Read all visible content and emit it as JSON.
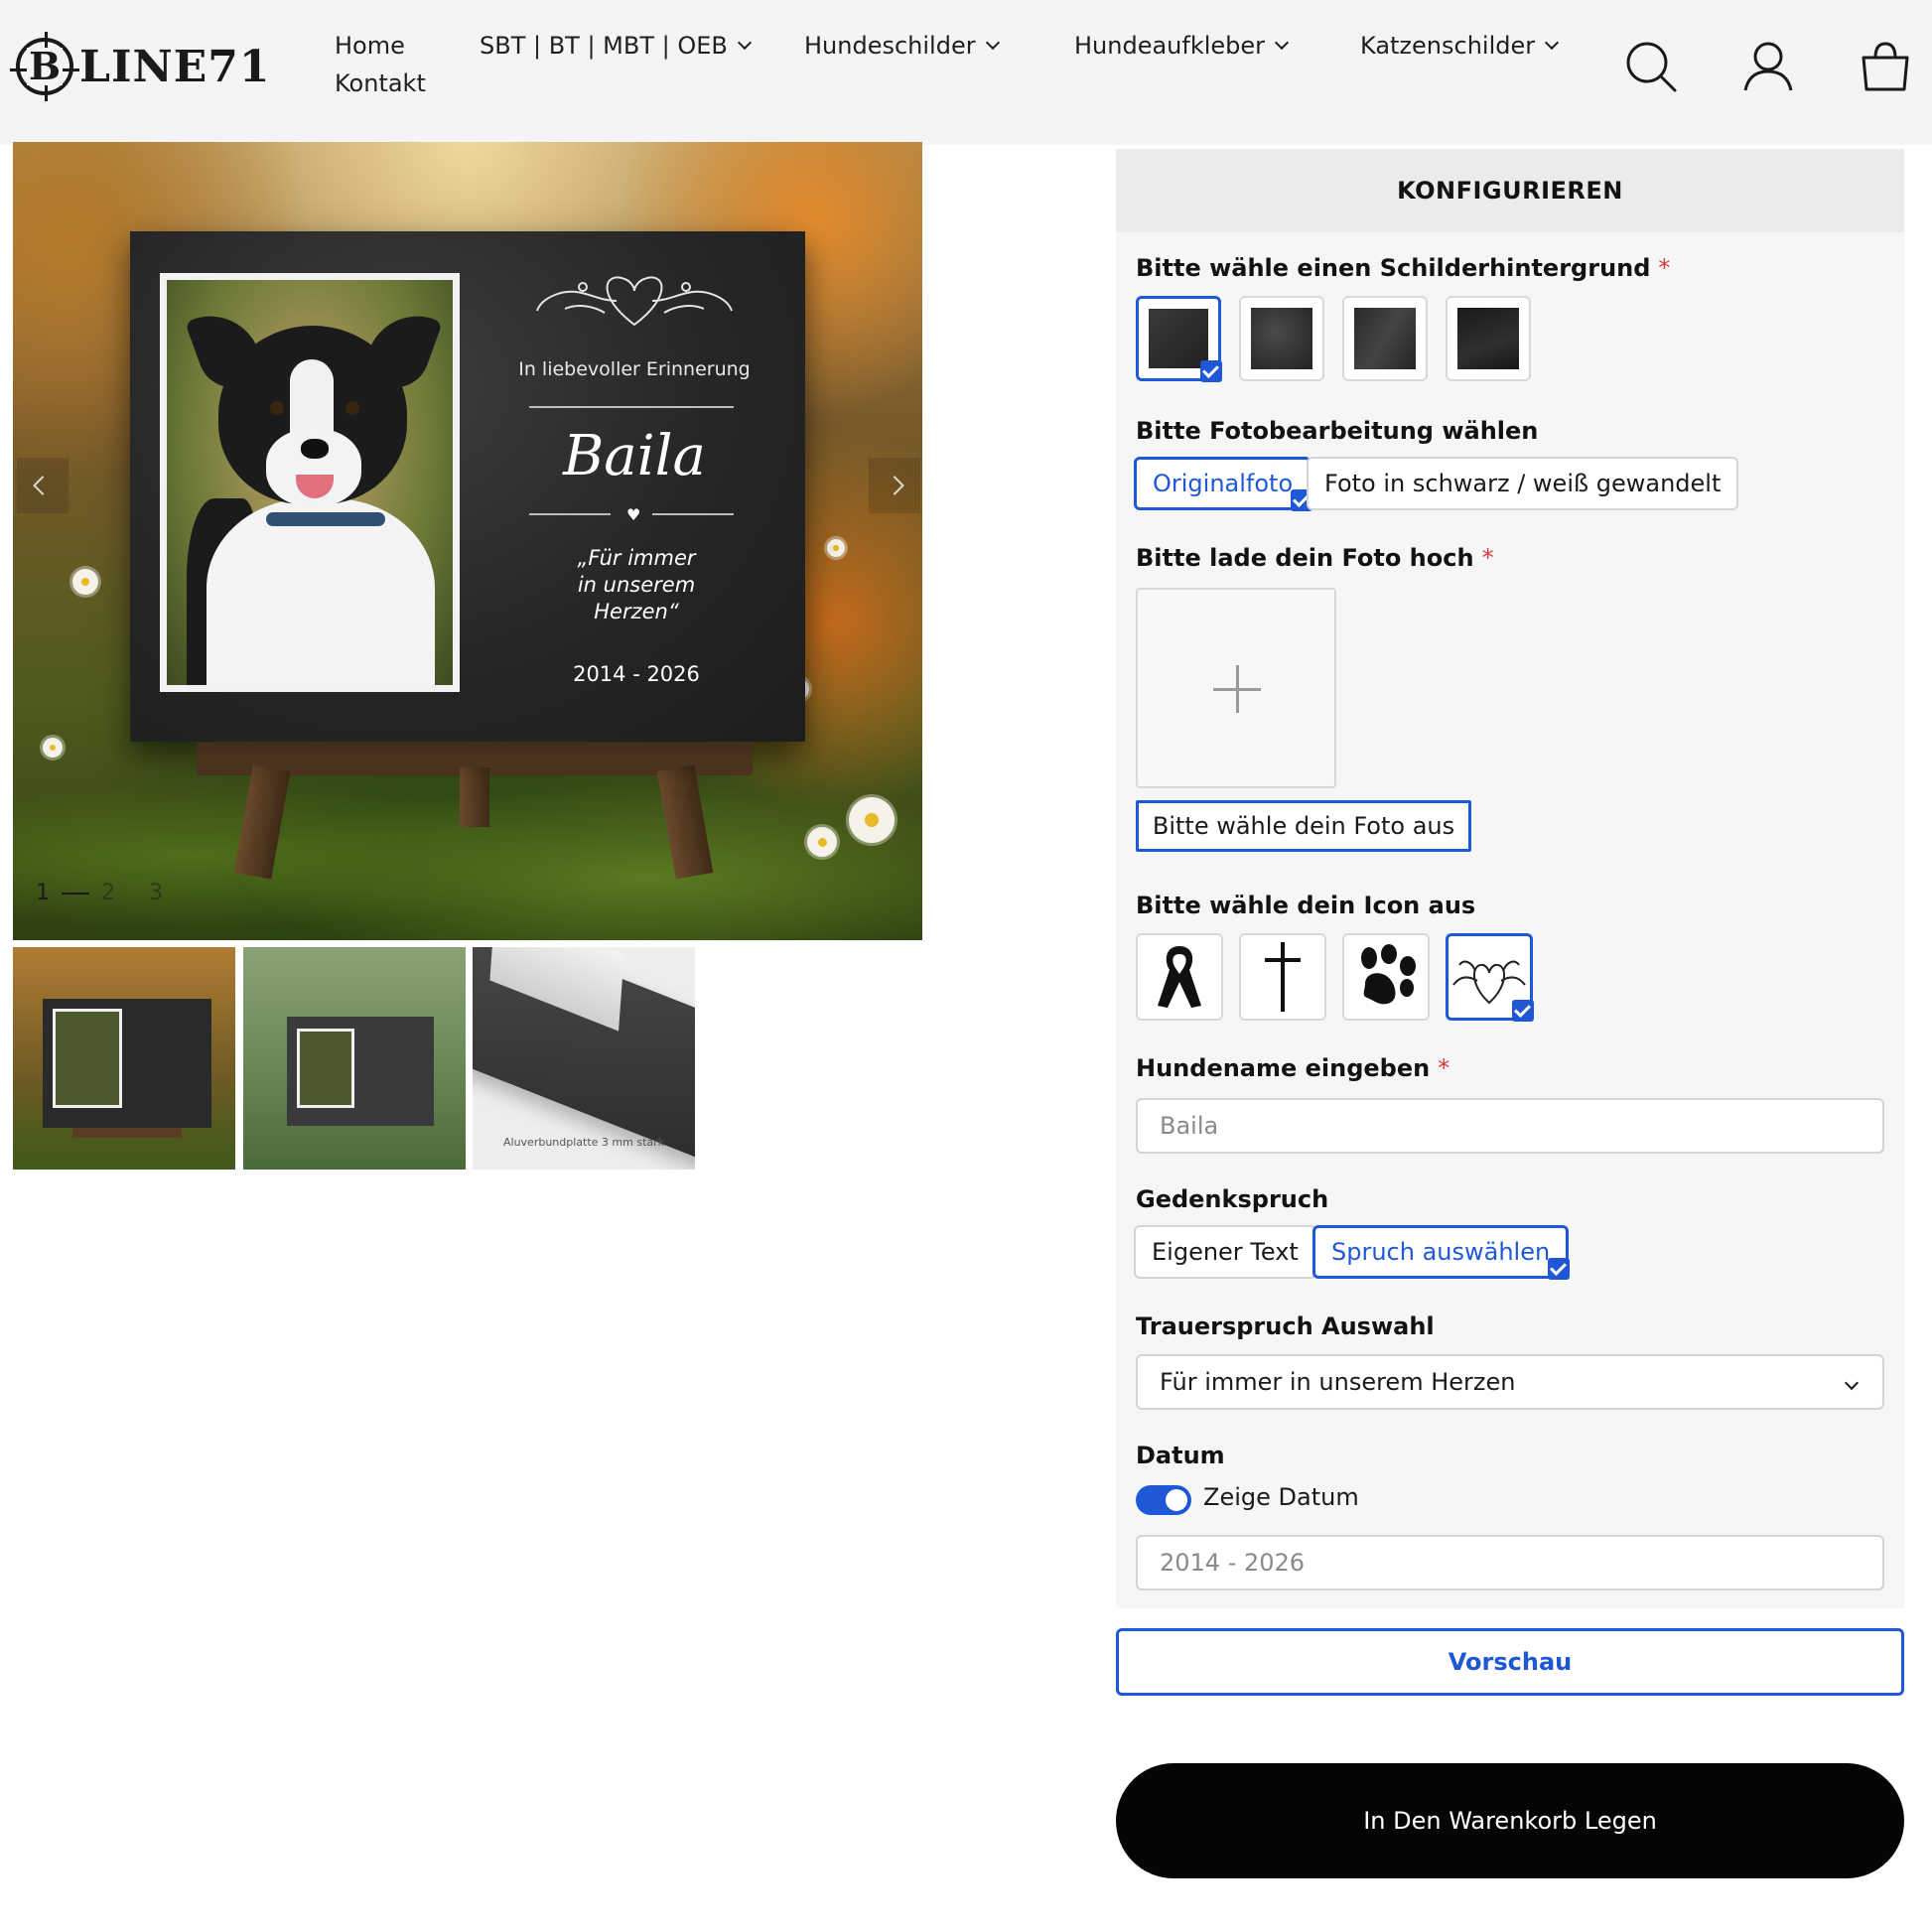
{
  "header": {
    "logo_letter": "B",
    "logo_text": "LINE71",
    "nav": [
      {
        "label": "Home"
      },
      {
        "label": "SBT | BT | MBT | OEB"
      },
      {
        "label": "Hundeschilder"
      },
      {
        "label": "Hundeaufkleber"
      },
      {
        "label": "Katzenschilder"
      },
      {
        "label": "Kontakt"
      }
    ],
    "icons": [
      "search-icon",
      "account-icon",
      "cart-icon"
    ]
  },
  "gallery": {
    "plaque": {
      "subtitle": "In liebevoller Erinnerung",
      "name": "Baila",
      "quote_lines": [
        "„Für immer",
        "in unserem",
        "Herzen“"
      ],
      "dates": "2014 - 2026"
    },
    "counter": {
      "current": "1",
      "second": "2",
      "third": "3"
    },
    "thumb_caption": "Aluverbundplatte 3 mm stark"
  },
  "config": {
    "title": "KONFIGURIEREN",
    "background_label": "Bitte wähle einen Schilderhintergrund",
    "required_mark": "*",
    "backgrounds": [
      {
        "name": "background-1",
        "selected": true,
        "color": "#2b2b2b"
      },
      {
        "name": "background-2",
        "selected": false,
        "color": "#333333"
      },
      {
        "name": "background-3",
        "selected": false,
        "color": "#2e2e2e"
      },
      {
        "name": "background-4",
        "selected": false,
        "color": "#1e1e1e"
      }
    ],
    "photo_edit_label": "Bitte Fotobearbeitung wählen",
    "photo_edit_options": [
      {
        "label": "Originalfoto",
        "selected": true
      },
      {
        "label": "Foto in schwarz / weiß gewandelt",
        "selected": false
      }
    ],
    "upload_label": "Bitte lade dein Foto hoch",
    "upload_button": "Bitte wähle dein Foto aus",
    "icon_label": "Bitte wähle dein Icon aus",
    "icons": [
      {
        "name": "ribbon-icon",
        "selected": false
      },
      {
        "name": "cross-icon",
        "selected": false
      },
      {
        "name": "paw-icon",
        "selected": false
      },
      {
        "name": "heart-ornament-icon",
        "selected": true
      }
    ],
    "dogname_label": "Hundename eingeben",
    "dogname_value": "Baila",
    "saying_label": "Gedenkspruch",
    "saying_options": [
      {
        "label": "Eigener Text",
        "selected": false
      },
      {
        "label": "Spruch auswählen",
        "selected": true
      }
    ],
    "mourning_label": "Trauerspruch Auswahl",
    "mourning_value": "Für immer in unserem Herzen",
    "date_label": "Datum",
    "show_date_label": "Zeige Datum",
    "show_date_on": true,
    "date_value": "2014 - 2026"
  },
  "actions": {
    "preview": "Vorschau",
    "add_to_cart": "In Den Warenkorb Legen"
  },
  "colors": {
    "accent": "#1f58d6",
    "header_bg": "#f4f4f4",
    "required": "#d53b3b",
    "cart_button": "#050505"
  }
}
